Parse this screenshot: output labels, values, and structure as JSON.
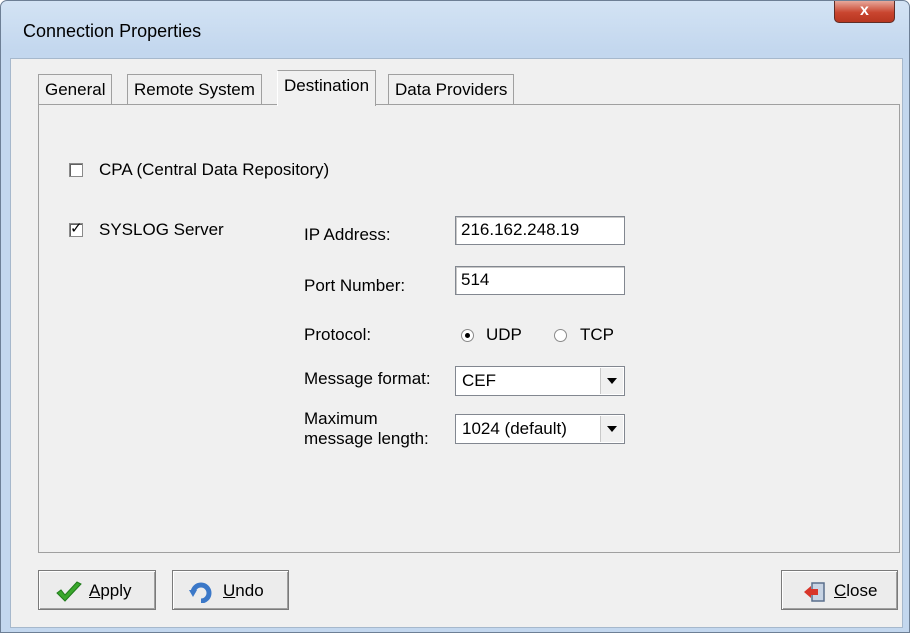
{
  "window": {
    "title": "Connection Properties",
    "close_glyph": "x"
  },
  "tabs": [
    {
      "label": "General"
    },
    {
      "label": "Remote System"
    },
    {
      "label": "Destination"
    },
    {
      "label": "Data Providers"
    }
  ],
  "active_tab": "Destination",
  "destination": {
    "cpa": {
      "label": "CPA (Central Data Repository)",
      "checked": false
    },
    "syslog": {
      "label": "SYSLOG Server",
      "checked": true,
      "check_glyph": "✓"
    },
    "ip_address": {
      "label": "IP Address:",
      "value": "216.162.248.19"
    },
    "port_number": {
      "label": "Port Number:",
      "value": "514"
    },
    "protocol": {
      "label": "Protocol:",
      "options": [
        "UDP",
        "TCP"
      ],
      "selected": "UDP"
    },
    "message_format": {
      "label": "Message format:",
      "value": "CEF"
    },
    "max_length": {
      "label_line1": "Maximum",
      "label_line2": "message length:",
      "value": "1024 (default)"
    }
  },
  "buttons": {
    "apply": {
      "prefix": "",
      "mnemonic": "A",
      "rest": "pply",
      "icon": "checkmark-icon"
    },
    "undo": {
      "prefix": "",
      "mnemonic": "U",
      "rest": "ndo",
      "icon": "undo-icon"
    },
    "close": {
      "prefix": "",
      "mnemonic": "C",
      "rest": "lose",
      "icon": "exit-door-icon"
    }
  },
  "colors": {
    "close_button": "#c9452f",
    "title_bar": "#c3d7ee",
    "check_green": "#3aa72c",
    "undo_blue": "#3b78c8",
    "exit_red": "#d8352a"
  }
}
